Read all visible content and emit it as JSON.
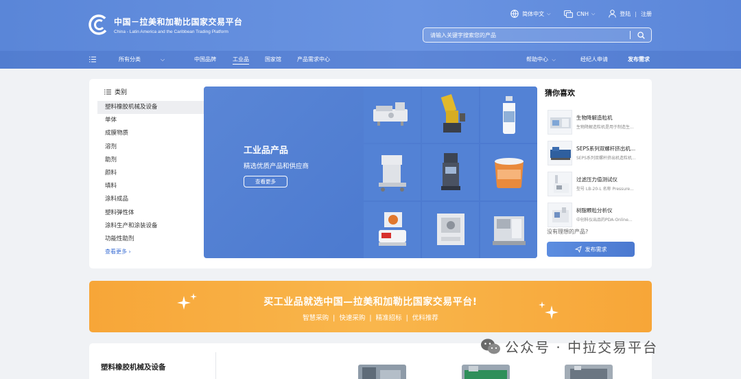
{
  "header": {
    "logo_title": "中国－拉美和加勒比国家交易平台",
    "logo_subtitle": "China - Latin America and the Caribbean Trading Platform",
    "language": "简体中文",
    "currency": "CNH",
    "login": "登陆",
    "register": "注册",
    "search_placeholder": "请输入关键字搜索您的产品"
  },
  "nav": {
    "all_categories": "所有分类",
    "items": [
      "中国品牌",
      "工业品",
      "国家馆",
      "产品需求中心"
    ],
    "help": "帮助中心",
    "broker": "经纪人申请",
    "publish": "发布需求"
  },
  "categories": {
    "heading": "类别",
    "items": [
      "塑料橡胶机械及设备",
      "单体",
      "成膜物质",
      "溶剂",
      "助剂",
      "颜料",
      "填料",
      "涂料成品",
      "塑料弹性体",
      "涂料生产和涂装设备",
      "功能性助剂"
    ],
    "more": "查看更多"
  },
  "banner": {
    "title": "工业品产品",
    "subtitle": "精选优质产品和供应商",
    "button": "查看更多"
  },
  "guess": {
    "title": "猜你喜欢",
    "items": [
      {
        "name": "生物降解造粒机",
        "desc": "生物降解造粒机是用于制造生..."
      },
      {
        "name": "SEPS系列双螺杆挤出机造...",
        "desc": "SEPS系列双螺杆挤出机造粒机..."
      },
      {
        "name": "过滤压力值测试仪",
        "desc": "型号 LB-20-L 名称 Pressure..."
      },
      {
        "name": "树脂颗粒分析仪",
        "desc": "中创科仪出品的PDA-Online..."
      }
    ],
    "ideal_prompt": "没有理想的产品?",
    "publish_button": "发布需求"
  },
  "promo": {
    "title": "买工业品就选中国—拉美和加勒比国家交易平台!",
    "tags": [
      "智慧采购",
      "快速采购",
      "精准招标",
      "优料推荐"
    ]
  },
  "section": {
    "title": "塑料橡胶机械及设备"
  },
  "watermark": "公众号 · 中拉交易平台",
  "colors": {
    "header": "#6690de",
    "accent": "#3c6fd4",
    "promo": "#f8ad42"
  }
}
